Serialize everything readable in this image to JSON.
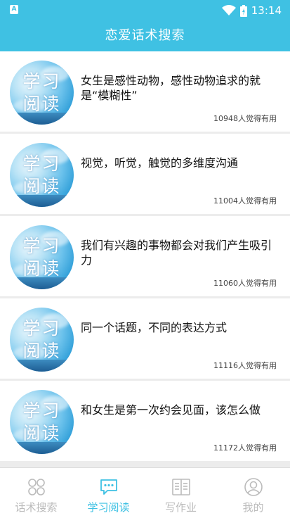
{
  "status_bar": {
    "time": "13:14",
    "app_badge": "A"
  },
  "header": {
    "title": "恋爱话术搜索"
  },
  "thumb_text": {
    "line1": "学习",
    "line2": "阅读"
  },
  "articles": [
    {
      "title": "女生是感性动物，感性动物追求的就是“模糊性”",
      "meta": "10948人觉得有用"
    },
    {
      "title": "视觉，听觉，触觉的多维度沟通",
      "meta": "11004人觉得有用"
    },
    {
      "title": "我们有兴趣的事物都会对我们产生吸引力",
      "meta": "11060人觉得有用"
    },
    {
      "title": "同一个话题，不同的表达方式",
      "meta": "11116人觉得有用"
    },
    {
      "title": "和女生是第一次约会见面，该怎么做",
      "meta": "11172人觉得有用"
    }
  ],
  "tabs": [
    {
      "label": "话术搜索",
      "icon": "grid-icon",
      "active": false
    },
    {
      "label": "学习阅读",
      "icon": "chat-icon",
      "active": true
    },
    {
      "label": "写作业",
      "icon": "book-icon",
      "active": false
    },
    {
      "label": "我的",
      "icon": "person-icon",
      "active": false
    }
  ],
  "colors": {
    "accent": "#3fc1e3",
    "inactive": "#bbbbbb"
  }
}
